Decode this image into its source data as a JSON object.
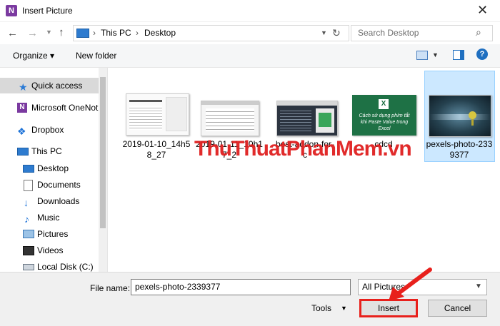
{
  "window": {
    "title": "Insert Picture",
    "app_icon_letter": "N"
  },
  "address": {
    "crumbs": [
      "This PC",
      "Desktop"
    ]
  },
  "search": {
    "placeholder": "Search Desktop"
  },
  "toolbar": {
    "organize": "Organize ▾",
    "new_folder": "New folder"
  },
  "sidebar": {
    "items": [
      {
        "label": "Quick access",
        "icon": "star-icon"
      },
      {
        "label": "Microsoft OneNot",
        "icon": "onenote-icon"
      },
      {
        "label": "Dropbox",
        "icon": "dropbox-icon"
      },
      {
        "label": "This PC",
        "icon": "computer-icon"
      },
      {
        "label": "Desktop",
        "icon": "desktop-folder-icon"
      },
      {
        "label": "Documents",
        "icon": "documents-folder-icon"
      },
      {
        "label": "Downloads",
        "icon": "downloads-folder-icon"
      },
      {
        "label": "Music",
        "icon": "music-folder-icon"
      },
      {
        "label": "Pictures",
        "icon": "pictures-folder-icon"
      },
      {
        "label": "Videos",
        "icon": "videos-folder-icon"
      },
      {
        "label": "Local Disk (C:)",
        "icon": "drive-icon"
      }
    ]
  },
  "files": [
    {
      "name_line1": "2019-01-10_14h5",
      "name_line2": "8_27"
    },
    {
      "name_line1": "2019-01-11_10h1",
      "name_line2": "7_2"
    },
    {
      "name_line1": "best-addon-for-",
      "name_line2": "c"
    },
    {
      "name_line1": "cdcd",
      "name_line2": "",
      "thumb_text": "Cách sử dụng phím tắt khi Paste Value trong Excel"
    },
    {
      "name_line1": "pexels-photo-233",
      "name_line2": "9377"
    }
  ],
  "watermark": "ThuThuatPhanMem.vn",
  "bottom": {
    "filename_label": "File name:",
    "filename_value": "pexels-photo-2339377",
    "filetype_value": "All Pictures",
    "tools_label": "Tools",
    "insert_label": "Insert",
    "cancel_label": "Cancel"
  },
  "colors": {
    "accent": "#1f6fc0",
    "highlight": "#e8201c",
    "selection": "#cce8ff"
  }
}
